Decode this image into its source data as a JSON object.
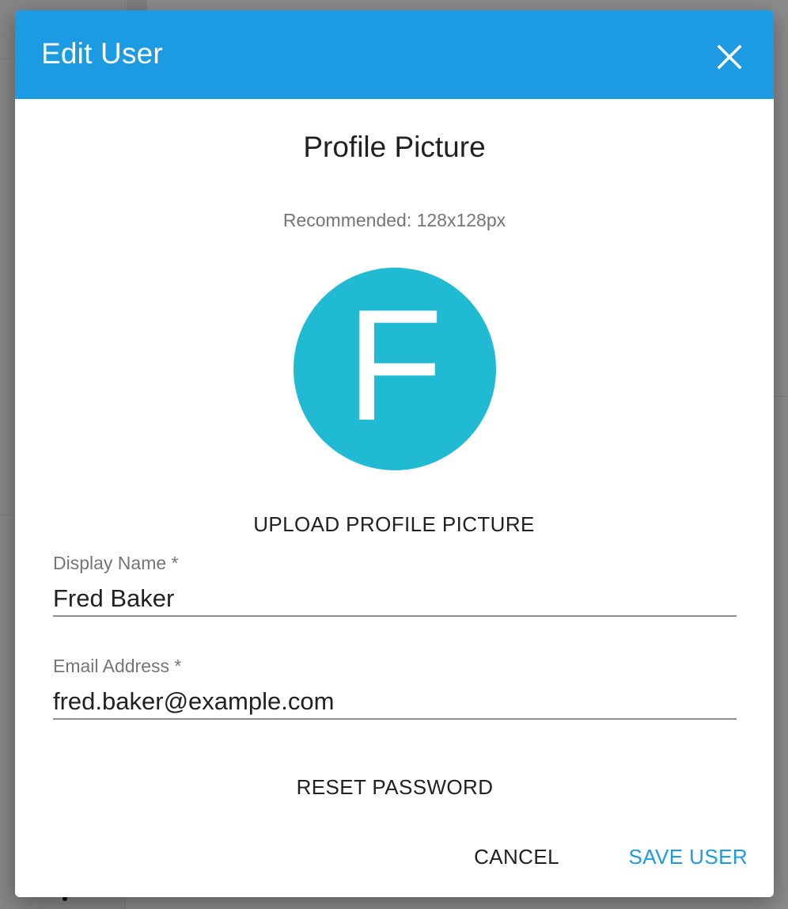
{
  "dialog": {
    "title": "Edit User",
    "header_color": "#1c9be2"
  },
  "profile": {
    "section_title": "Profile Picture",
    "recommendation": "Recommended: 128x128px",
    "avatar_letter": "F",
    "avatar_color": "#20bad3",
    "upload_label": "UPLOAD PROFILE PICTURE"
  },
  "form": {
    "display_name": {
      "label": "Display Name *",
      "value": "Fred Baker"
    },
    "email": {
      "label": "Email Address *",
      "value": "fred.baker@example.com"
    }
  },
  "actions": {
    "reset_password": "RESET PASSWORD",
    "cancel": "CANCEL",
    "save": "SAVE USER",
    "accent_color": "#1c9be2"
  },
  "icons": {
    "close": "close-icon"
  }
}
